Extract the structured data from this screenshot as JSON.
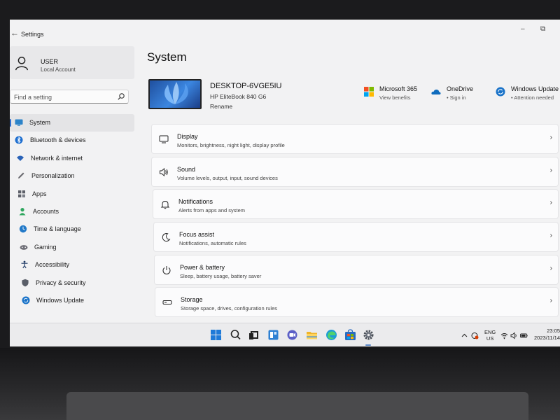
{
  "window": {
    "title": "Settings",
    "minimize_glyph": "–",
    "maximize_glyph": "⧉"
  },
  "user": {
    "name": "USER",
    "account_type": "Local Account"
  },
  "search": {
    "placeholder": "Find a setting"
  },
  "nav": {
    "items": [
      {
        "label": "System",
        "icon": "monitor-icon",
        "selected": true
      },
      {
        "label": "Bluetooth & devices",
        "icon": "bluetooth-icon"
      },
      {
        "label": "Network & internet",
        "icon": "wifi-icon"
      },
      {
        "label": "Personalization",
        "icon": "pen-icon"
      },
      {
        "label": "Apps",
        "icon": "apps-icon"
      },
      {
        "label": "Accounts",
        "icon": "accounts-icon"
      },
      {
        "label": "Time & language",
        "icon": "globe-clock-icon"
      },
      {
        "label": "Gaming",
        "icon": "controller-icon"
      },
      {
        "label": "Accessibility",
        "icon": "accessibility-icon"
      },
      {
        "label": "Privacy & security",
        "icon": "shield-icon"
      },
      {
        "label": "Windows Update",
        "icon": "update-icon"
      }
    ]
  },
  "page": {
    "title": "System"
  },
  "device": {
    "name": "DESKTOP-6VGE5IU",
    "model": "HP EliteBook 840 G6",
    "rename_label": "Rename"
  },
  "quick_links": [
    {
      "title": "Microsoft 365",
      "subtitle": "View benefits",
      "icon": "microsoft-365-icon"
    },
    {
      "title": "OneDrive",
      "subtitle": "• Sign in",
      "icon": "onedrive-icon"
    },
    {
      "title": "Windows Update",
      "subtitle": "• Attention needed",
      "icon": "windows-update-icon"
    }
  ],
  "settings": [
    {
      "title": "Display",
      "subtitle": "Monitors, brightness, night light, display profile",
      "icon": "display-icon"
    },
    {
      "title": "Sound",
      "subtitle": "Volume levels, output, input, sound devices",
      "icon": "speaker-icon"
    },
    {
      "title": "Notifications",
      "subtitle": "Alerts from apps and system",
      "icon": "bell-icon"
    },
    {
      "title": "Focus assist",
      "subtitle": "Notifications, automatic rules",
      "icon": "moon-icon"
    },
    {
      "title": "Power & battery",
      "subtitle": "Sleep, battery usage, battery saver",
      "icon": "power-icon"
    },
    {
      "title": "Storage",
      "subtitle": "Storage space, drives, configuration rules",
      "icon": "storage-icon"
    }
  ],
  "chevron_glyph": "›",
  "taskbar": {
    "apps": [
      "windows-start-icon",
      "search-icon",
      "task-view-icon",
      "widgets-icon",
      "teams-chat-icon",
      "file-explorer-icon",
      "edge-icon",
      "store-icon",
      "settings-gear-icon"
    ],
    "tray": {
      "lang_primary": "ENG",
      "lang_secondary": "US",
      "time": "23:05",
      "date": "2023/11/14"
    }
  },
  "colors": {
    "accent": "#2e6fd1",
    "ms365_red": "#f25022",
    "ms365_green": "#7fba00",
    "ms365_blue": "#00a4ef",
    "ms365_yellow": "#ffb900",
    "onedrive_blue": "#0f6cbd",
    "update_blue": "#1a73c8"
  }
}
